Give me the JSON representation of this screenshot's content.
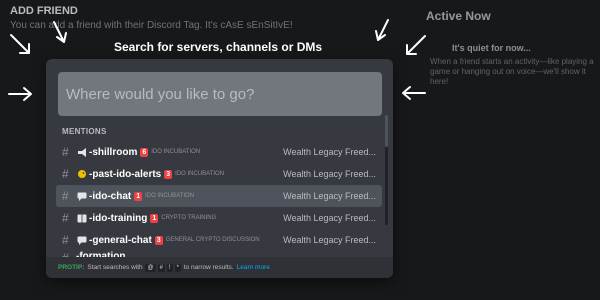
{
  "background": {
    "add_friend_title": "ADD FRIEND",
    "add_friend_desc": "You can add a friend with their Discord Tag. It's cAsE sEnSitIvE!",
    "active_now": "Active Now",
    "quiet_title": "It's quiet for now...",
    "quiet_desc": "When a friend starts an activity—like playing a game or hanging out on voice—we'll show it here!"
  },
  "modal": {
    "heading": "Search for servers, channels or DMs",
    "search_placeholder": "Where would you like to go?",
    "section_title": "MENTIONS",
    "rows": [
      {
        "hash": "#",
        "emoji": "megaphone-icon",
        "name": "-shillroom",
        "badge": "6",
        "category": "IDO INCUBATION",
        "server": "Wealth Legacy Freed...",
        "selected": false
      },
      {
        "hash": "#",
        "emoji": "chick-icon",
        "name": "-past-ido-alerts",
        "badge": "3",
        "category": "IDO INCUBATION",
        "server": "Wealth Legacy Freed...",
        "selected": false
      },
      {
        "hash": "#",
        "emoji": "speech-icon",
        "name": "-ido-chat",
        "badge": "1",
        "category": "IDO INCUBATION",
        "server": "Wealth Legacy Freed...",
        "selected": true
      },
      {
        "hash": "#",
        "emoji": "book-icon",
        "name": "-ido-training",
        "badge": "1",
        "category": "CRYPTO TRAINING",
        "server": "Wealth Legacy Freed...",
        "selected": false
      },
      {
        "hash": "#",
        "emoji": "speech-icon",
        "name": "-general-chat",
        "badge": "3",
        "category": "GENERAL CRYPTO DISCUSSION",
        "server": "Wealth Legacy Freed...",
        "selected": false
      },
      {
        "hash": "#",
        "emoji": "",
        "name": "-formation",
        "badge": "",
        "category": "",
        "server": "",
        "selected": false
      }
    ],
    "protip": {
      "label": "PROTIP:",
      "text_before": "Start searches with",
      "keys": [
        "@",
        "#",
        "!",
        "*"
      ],
      "text_after": "to narrow results.",
      "link": "Learn more"
    }
  },
  "colors": {
    "accent_green": "#3ba55d",
    "badge_red": "#ed4245",
    "link_blue": "#00aff4"
  }
}
